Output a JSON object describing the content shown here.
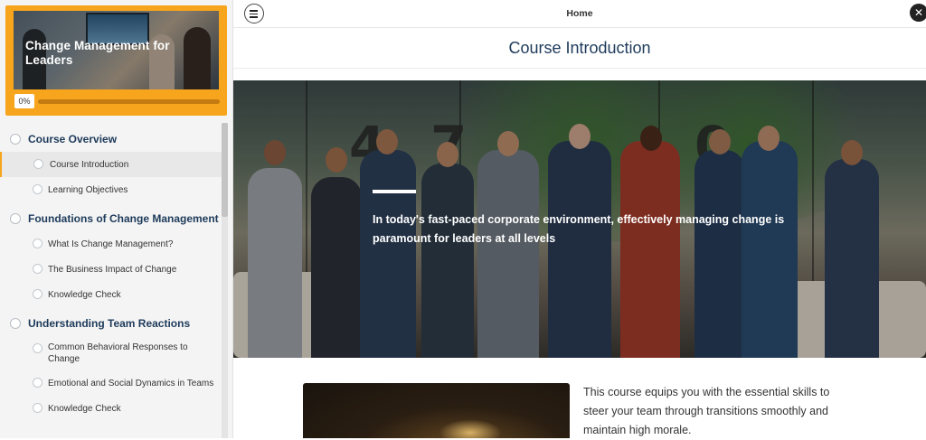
{
  "course": {
    "title": "Change Management for Leaders",
    "progress_label": "0%",
    "progress_value": 0
  },
  "sidebar": {
    "sections": [
      {
        "title": "Course Overview",
        "lessons": [
          {
            "label": "Course Introduction",
            "active": true
          },
          {
            "label": "Learning Objectives",
            "active": false
          }
        ]
      },
      {
        "title": "Foundations of Change Management",
        "lessons": [
          {
            "label": "What Is Change Management?",
            "active": false
          },
          {
            "label": "The Business Impact of Change",
            "active": false
          },
          {
            "label": "Knowledge Check",
            "active": false
          }
        ]
      },
      {
        "title": "Understanding Team Reactions",
        "lessons": [
          {
            "label": "Common Behavioral Responses to Change",
            "active": false
          },
          {
            "label": "Emotional and Social Dynamics in Teams",
            "active": false
          },
          {
            "label": "Knowledge Check",
            "active": false
          }
        ]
      }
    ]
  },
  "topbar": {
    "title": "Home",
    "menu_icon": "hamburger-icon",
    "close_icon": "close-icon"
  },
  "main": {
    "page_title": "Course Introduction",
    "hero_text": "In today's fast-paced corporate environment, effectively managing change is paramount for leaders at all levels",
    "body_text": "This course equips you with the essential skills to steer your team through transitions smoothly and maintain high morale."
  },
  "colors": {
    "accent": "#f7a51c",
    "heading": "#1d3a5a"
  }
}
